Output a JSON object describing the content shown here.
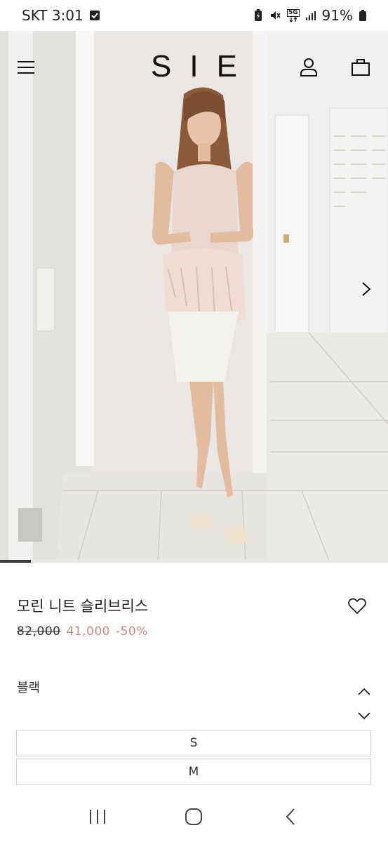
{
  "status_bar": {
    "carrier_time": "SKT 3:01",
    "network": "5G",
    "battery": "91%"
  },
  "header": {
    "logo": "SIE"
  },
  "gallery": {
    "progress": 0.08
  },
  "product": {
    "name": "모린 니트 슬리브리스",
    "original_price": "82,000",
    "sale_price": "41,000",
    "discount": "-50%",
    "color": "블랙",
    "sizes": [
      "S",
      "M"
    ]
  }
}
